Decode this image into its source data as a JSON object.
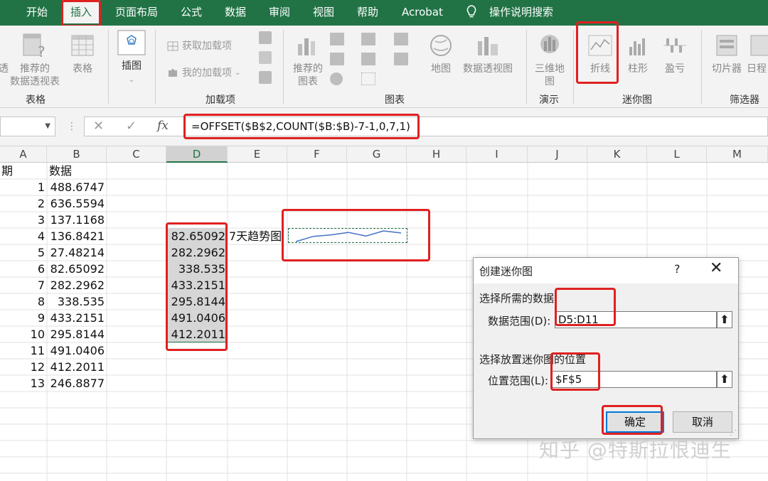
{
  "menu": {
    "tabs": [
      {
        "label": "开始"
      },
      {
        "label": "插入"
      },
      {
        "label": "页面布局"
      },
      {
        "label": "公式"
      },
      {
        "label": "数据"
      },
      {
        "label": "审阅"
      },
      {
        "label": "视图"
      },
      {
        "label": "帮助"
      },
      {
        "label": "Acrobat"
      }
    ],
    "search_label": "操作说明搜索"
  },
  "ribbon": {
    "tables_group": {
      "label": "表格",
      "recommended_pivot_line1": "推荐的",
      "recommended_pivot_line2": "数据透视表",
      "table": "表格"
    },
    "illustrations": {
      "label": "插图"
    },
    "addins_group": {
      "label": "加载项",
      "get_addins": "获取加载项",
      "my_addins": "我的加载项"
    },
    "charts_group": {
      "label": "图表",
      "recommended_line1": "推荐的",
      "recommended_line2": "图表",
      "map": "地图",
      "pivot_chart": "数据透视图"
    },
    "tours_group": {
      "label": "演示",
      "map3d_line1": "三维地",
      "map3d_line2": "图"
    },
    "sparklines_group": {
      "label": "迷你图",
      "line": "折线",
      "column": "柱形",
      "winloss": "盈亏"
    },
    "filters_group": {
      "label": "筛选器",
      "slicer": "切片器",
      "timeline": "日程"
    }
  },
  "formula_bar": {
    "cancel": "✕",
    "enter": "✓",
    "fx": "fx",
    "formula": "=OFFSET($B$2,COUNT($B:$B)-7-1,0,7,1)"
  },
  "columns": [
    "A",
    "B",
    "C",
    "D",
    "E",
    "F",
    "G",
    "H",
    "I",
    "J",
    "K",
    "L",
    "M"
  ],
  "sheet": {
    "header_a": "期",
    "header_b": "数据",
    "rows": [
      {
        "a": "1",
        "b": "488.6747"
      },
      {
        "a": "2",
        "b": "636.5594"
      },
      {
        "a": "3",
        "b": "137.1168"
      },
      {
        "a": "4",
        "b": "136.8421"
      },
      {
        "a": "5",
        "b": "27.48214"
      },
      {
        "a": "6",
        "b": "82.65092"
      },
      {
        "a": "7",
        "b": "282.2962"
      },
      {
        "a": "8",
        "b": "338.535"
      },
      {
        "a": "9",
        "b": "433.2151"
      },
      {
        "a": "10",
        "b": "295.8144"
      },
      {
        "a": "11",
        "b": "491.0406"
      },
      {
        "a": "12",
        "b": "412.2011"
      },
      {
        "a": "13",
        "b": "246.8877"
      }
    ],
    "d_values": [
      "82.65092",
      "282.2962",
      "338.535",
      "433.2151",
      "295.8144",
      "491.0406",
      "412.2011"
    ],
    "e_label": "7天趋势图"
  },
  "sparkline": {
    "values": [
      82.65092,
      282.2962,
      338.535,
      433.2151,
      295.8144,
      491.0406,
      412.2011
    ],
    "color": "#4472c4"
  },
  "dialog": {
    "title": "创建迷你图",
    "help": "?",
    "close": "✕",
    "section1": "选择所需的数据",
    "data_range_label": "数据范围(D):",
    "data_range_value": "D5:D11",
    "section2": "选择放置迷你图的位置",
    "location_label": "位置范围(L):",
    "location_value": "$F$5",
    "ok": "确定",
    "cancel": "取消"
  },
  "watermark": "知乎 @特斯拉恨迪生",
  "colors": {
    "excel_green": "#217346",
    "annotation_red": "#e02020"
  }
}
